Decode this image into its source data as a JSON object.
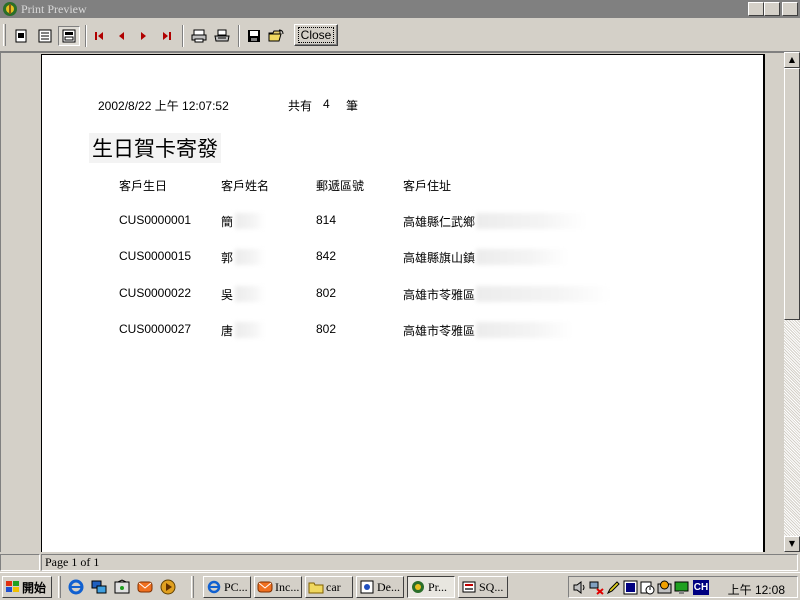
{
  "window": {
    "title": "Print Preview",
    "minimize": "_",
    "restore": "▣",
    "close": "✕"
  },
  "toolbar": {
    "close_label": "Close",
    "icons": [
      "single-page-icon",
      "multi-page-icon",
      "zoom-page-icon",
      "first-page-icon",
      "previous-page-icon",
      "next-page-icon",
      "last-page-icon",
      "print-setup-icon",
      "print-icon",
      "save-icon",
      "open-icon"
    ]
  },
  "report": {
    "timestamp": "2002/8/22 上午 12:07:52",
    "count_prefix": "共有",
    "count": "4",
    "count_suffix": "筆",
    "title": "生日賀卡寄發",
    "columns": [
      "客戶生日",
      "客戶姓名",
      "郵遞區號",
      "客戶住址"
    ],
    "rows": [
      {
        "id": "CUS0000001",
        "name": "簡",
        "zip": "814",
        "address": "高雄縣仁武鄉"
      },
      {
        "id": "CUS0000015",
        "name": "郭",
        "zip": "842",
        "address": "高雄縣旗山鎮"
      },
      {
        "id": "CUS0000022",
        "name": "吳",
        "zip": "802",
        "address": "高雄市苓雅區"
      },
      {
        "id": "CUS0000027",
        "name": "唐",
        "zip": "802",
        "address": "高雄市苓雅區"
      }
    ]
  },
  "status": {
    "page_info": "Page 1 of 1"
  },
  "taskbar": {
    "start_label": "開始",
    "tasks": [
      {
        "label": "PC..."
      },
      {
        "label": "Inc..."
      },
      {
        "label": "car"
      },
      {
        "label": "De..."
      },
      {
        "label": "Pr..."
      },
      {
        "label": "SQ..."
      }
    ],
    "clock": "上午 12:08",
    "lang": "CH"
  },
  "colors": {
    "titlebar_inactive": "#808080",
    "face": "#d4d0c8",
    "nav_arrow": "#b00000"
  }
}
